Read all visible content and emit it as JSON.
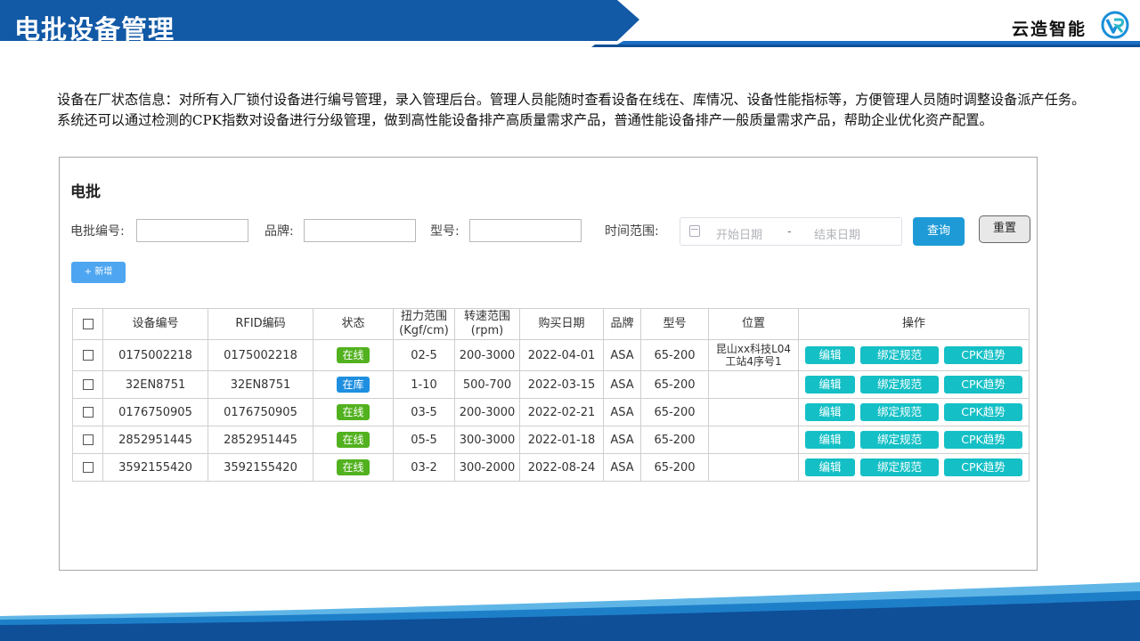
{
  "header": {
    "title": "电批设备管理",
    "brand": "云造智能",
    "colors": {
      "banner": "#1259a6",
      "accent_line": "#1a6fc4"
    }
  },
  "intro": "设备在厂状态信息：对所有入厂锁付设备进行编号管理，录入管理后台。管理人员能随时查看设备在线在、库情况、设备性能指标等，方便管理人员随时调整设备派产任务。系统还可以通过检测的CPK指数对设备进行分级管理，做到高性能设备排产高质量需求产品，普通性能设备排产一般质量需求产品，帮助企业优化资产配置。",
  "panel": {
    "title": "电批",
    "filters": {
      "code_label": "电批编号:",
      "brand_label": "品牌:",
      "model_label": "型号:",
      "time_label": "时间范围:",
      "start_placeholder": "开始日期",
      "separator": "-",
      "end_placeholder": "结束日期"
    },
    "buttons": {
      "query": "查询",
      "reset": "重置",
      "add": "+ 新增"
    }
  },
  "table": {
    "headers": {
      "code": "设备编号",
      "rfid": "RFID编码",
      "status": "状态",
      "torque": "扭力范围",
      "torque_unit": "(Kgf/cm)",
      "speed": "转速范围",
      "speed_unit": "(rpm)",
      "date": "购买日期",
      "brand": "品牌",
      "model": "型号",
      "position": "位置",
      "actions": "操作"
    },
    "actions": {
      "edit": "编辑",
      "bind": "绑定规范",
      "cpk": "CPK趋势"
    },
    "rows": [
      {
        "code": "0175002218",
        "rfid": "0175002218",
        "status": "在线",
        "torque": "02-5",
        "speed": "200-3000",
        "date": "2022-04-01",
        "brand": "ASA",
        "model": "65-200",
        "position_line1": "昆山xx科技L04",
        "position_line2": "工站4序号1"
      },
      {
        "code": "32EN8751",
        "rfid": "32EN8751",
        "status": "在库",
        "torque": "1-10",
        "speed": "500-700",
        "date": "2022-03-15",
        "brand": "ASA",
        "model": "65-200",
        "position_line1": "",
        "position_line2": ""
      },
      {
        "code": "0176750905",
        "rfid": "0176750905",
        "status": "在线",
        "torque": "03-5",
        "speed": "200-3000",
        "date": "2022-02-21",
        "brand": "ASA",
        "model": "65-200",
        "position_line1": "",
        "position_line2": ""
      },
      {
        "code": "2852951445",
        "rfid": "2852951445",
        "status": "在线",
        "torque": "05-5",
        "speed": "300-3000",
        "date": "2022-01-18",
        "brand": "ASA",
        "model": "65-200",
        "position_line1": "",
        "position_line2": ""
      },
      {
        "code": "3592155420",
        "rfid": "3592155420",
        "status": "在线",
        "torque": "03-2",
        "speed": "300-2000",
        "date": "2022-08-24",
        "brand": "ASA",
        "model": "65-200",
        "position_line1": "",
        "position_line2": ""
      }
    ],
    "status_colors": {
      "在线": "#52b11f",
      "在库": "#1e8fe0"
    },
    "action_color": "#14c0c6"
  }
}
